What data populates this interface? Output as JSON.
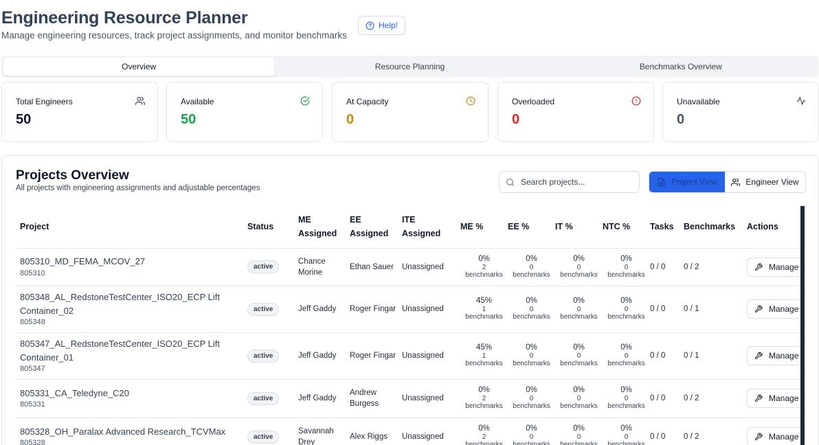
{
  "header": {
    "title": "Engineering Resource Planner",
    "subtitle": "Manage engineering resources, track project assignments, and monitor benchmarks",
    "help_label": "Help!"
  },
  "tabs": [
    {
      "label": "Overview",
      "active": true
    },
    {
      "label": "Resource Planning",
      "active": false
    },
    {
      "label": "Benchmarks Overview",
      "active": false
    }
  ],
  "stats": [
    {
      "label": "Total Engineers",
      "value": "50",
      "icon": "users-icon",
      "color": "#0f172a"
    },
    {
      "label": "Available",
      "value": "50",
      "icon": "check-circle-icon",
      "color": "#16a34a"
    },
    {
      "label": "At Capacity",
      "value": "0",
      "icon": "clock-icon",
      "color": "#ca8a04"
    },
    {
      "label": "Overloaded",
      "value": "0",
      "icon": "alert-circle-icon",
      "color": "#dc2626"
    },
    {
      "label": "Unavailable",
      "value": "0",
      "icon": "activity-icon",
      "color": "#475569"
    }
  ],
  "projects": {
    "title": "Projects Overview",
    "subtitle": "All projects with engineering assignments and adjustable percentages",
    "search_placeholder": "Search projects...",
    "view_project_label": "Project View",
    "view_engineer_label": "Engineer View",
    "columns": {
      "project": "Project",
      "status": "Status",
      "me_assigned_1": "ME",
      "me_assigned_2": "Assigned",
      "ee_assigned_1": "EE",
      "ee_assigned_2": "Assigned",
      "ite_assigned_1": "ITE",
      "ite_assigned_2": "Assigned",
      "me_pct": "ME %",
      "ee_pct": "EE %",
      "it_pct": "IT %",
      "ntc_pct": "NTC %",
      "tasks": "Tasks",
      "benchmarks": "Benchmarks",
      "actions": "Actions"
    },
    "manage_label": "Manage",
    "benchmarks_word": "benchmarks",
    "rows": [
      {
        "name": "805310_MD_FEMA_MCOV_27",
        "id": "805310",
        "status": "active",
        "me": "Chance Morine",
        "ee": "Ethan Sauer",
        "ite": "Unassigned",
        "me_pct": "0%",
        "me_cnt": "2",
        "ee_pct": "0%",
        "ee_cnt": "0",
        "it_pct": "0%",
        "it_cnt": "0",
        "ntc_pct": "0%",
        "ntc_cnt": "0",
        "tasks": "0 / 0",
        "benchmarks": "0 / 2"
      },
      {
        "name": "805348_AL_RedstoneTestCenter_ISO20_ECP Lift Container_02",
        "id": "805348",
        "status": "active",
        "me": "Jeff Gaddy",
        "ee": "Roger Fingar",
        "ite": "Unassigned",
        "me_pct": "45%",
        "me_cnt": "1",
        "ee_pct": "0%",
        "ee_cnt": "0",
        "it_pct": "0%",
        "it_cnt": "0",
        "ntc_pct": "0%",
        "ntc_cnt": "0",
        "tasks": "0 / 0",
        "benchmarks": "0 / 1"
      },
      {
        "name": "805347_AL_RedstoneTestCenter_ISO20_ECP Lift Container_01",
        "id": "805347",
        "status": "active",
        "me": "Jeff Gaddy",
        "ee": "Roger Fingar",
        "ite": "Unassigned",
        "me_pct": "45%",
        "me_cnt": "1",
        "ee_pct": "0%",
        "ee_cnt": "0",
        "it_pct": "0%",
        "it_cnt": "0",
        "ntc_pct": "0%",
        "ntc_cnt": "0",
        "tasks": "0 / 0",
        "benchmarks": "0 / 1"
      },
      {
        "name": "805331_CA_Teledyne_C20",
        "id": "805331",
        "status": "active",
        "me": "Jeff Gaddy",
        "ee": "Andrew Burgess",
        "ite": "Unassigned",
        "me_pct": "0%",
        "me_cnt": "2",
        "ee_pct": "0%",
        "ee_cnt": "0",
        "it_pct": "0%",
        "it_cnt": "0",
        "ntc_pct": "0%",
        "ntc_cnt": "0",
        "tasks": "0 / 0",
        "benchmarks": "0 / 2"
      },
      {
        "name": "805328_OH_Paralax Advanced Research_TCVMax",
        "id": "805328",
        "status": "active",
        "me": "Savannah Drey",
        "ee": "Alex Riggs",
        "ite": "Unassigned",
        "me_pct": "0%",
        "me_cnt": "2",
        "ee_pct": "0%",
        "ee_cnt": "0",
        "it_pct": "0%",
        "it_cnt": "0",
        "ntc_pct": "0%",
        "ntc_cnt": "0",
        "tasks": "0 / 0",
        "benchmarks": "0 / 2"
      }
    ]
  }
}
